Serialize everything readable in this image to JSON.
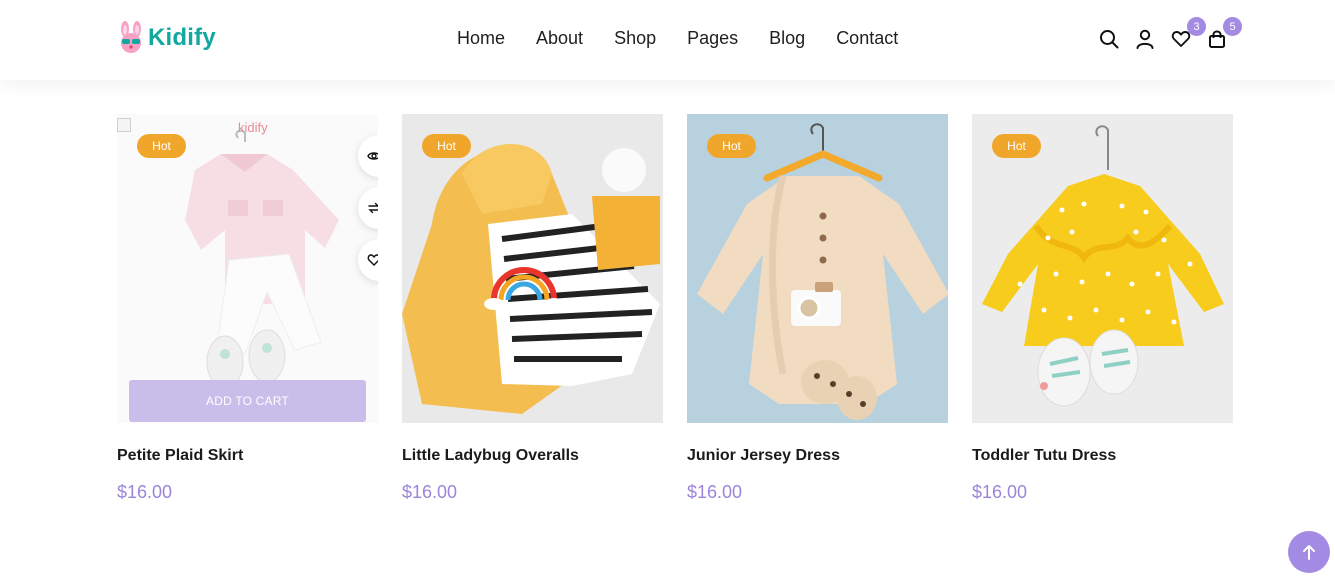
{
  "brand": {
    "logo_text": "Kidify",
    "accent": "#a38be3",
    "teal": "#12a7a0"
  },
  "nav": {
    "items": [
      "Home",
      "About",
      "Shop",
      "Pages",
      "Blog",
      "Contact"
    ]
  },
  "header_icons": {
    "search": "search-icon",
    "account": "user-icon",
    "wishlist": {
      "icon": "heart-icon",
      "count": "3"
    },
    "cart": {
      "icon": "bag-icon",
      "count": "5"
    }
  },
  "products": [
    {
      "title": "Petite Plaid Skirt",
      "price": "$16.00",
      "badge": "Hot",
      "image_brand": "kidify",
      "add_to_cart": "ADD TO CART",
      "hovered": true
    },
    {
      "title": "Little Ladybug Overalls",
      "price": "$16.00",
      "badge": "Hot"
    },
    {
      "title": "Junior Jersey Dress",
      "price": "$16.00",
      "badge": "Hot"
    },
    {
      "title": "Toddler Tutu Dress",
      "price": "$16.00",
      "badge": "Hot"
    }
  ],
  "colors": {
    "hot_badge": "#f0a62a",
    "price": "#9b85d9",
    "add_to_cart_bg": "#c9bde9"
  }
}
